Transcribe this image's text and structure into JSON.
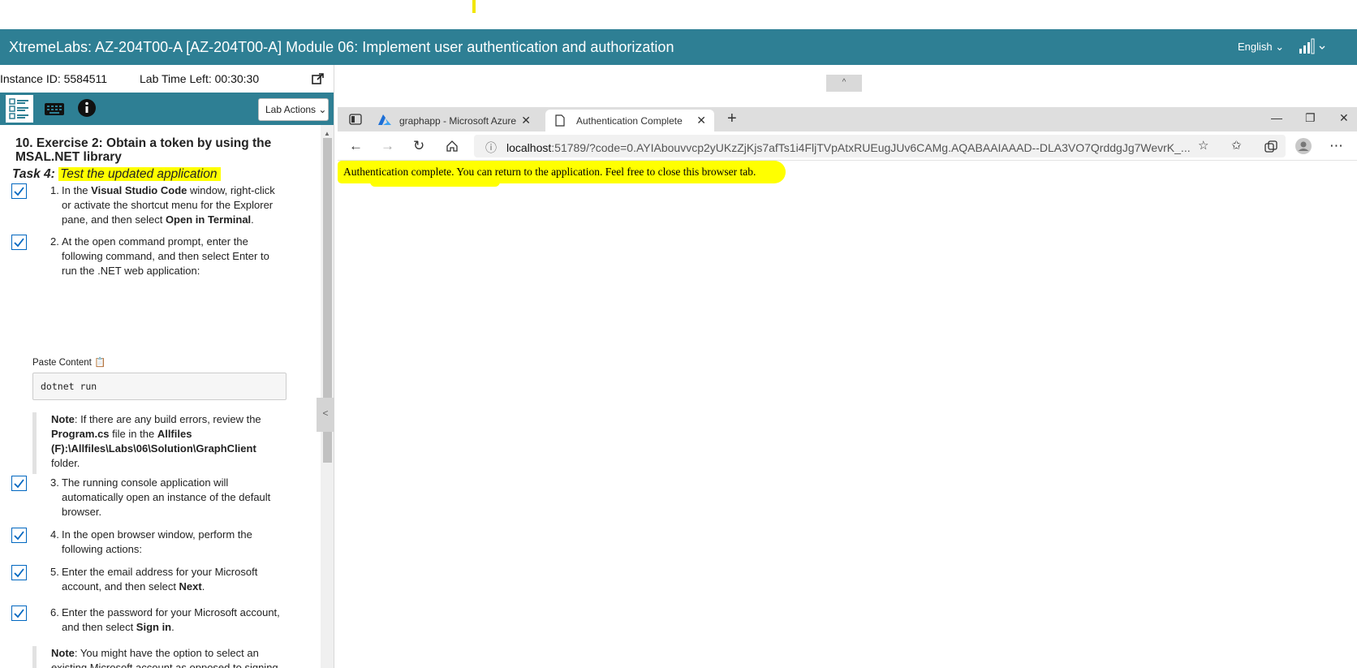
{
  "header": {
    "title": "XtremeLabs: AZ-204T00-A [AZ-204T00-A] Module 06: Implement user authentication and authorization",
    "language": "English"
  },
  "lab": {
    "instance_id": "Instance ID: 5584511",
    "time_left": "Lab Time Left: 00:30:30",
    "lab_actions": "Lab Actions"
  },
  "content": {
    "exercise_title": "10. Exercise 2: Obtain a token by using the MSAL.NET library",
    "task_prefix": "Task 4:",
    "task_title": "Test the updated application",
    "steps": [
      {
        "num": "1.",
        "pre": "In the ",
        "b1": "Visual Studio Code",
        "mid": " window, right-click or activate the shortcut menu for the Explorer pane, and then select ",
        "b2": "Open in Terminal",
        "post": ".",
        "checked": true
      },
      {
        "num": "2.",
        "pre": "At the open command prompt, enter the following command, and then select Enter to run the .NET web application:",
        "checked": true
      },
      {
        "num": "3.",
        "pre": "The running console application will automatically open an instance of the default browser.",
        "checked": true
      },
      {
        "num": "4.",
        "pre": "In the open browser window, perform the following actions:",
        "checked": true
      },
      {
        "num": "5.",
        "pre": "Enter the email address for your Microsoft account, and then select ",
        "b1": "Next",
        "post": ".",
        "checked": true
      },
      {
        "num": "6.",
        "pre": "Enter the password for your Microsoft account, and then select ",
        "b1": "Sign in",
        "post": ".",
        "checked": true
      }
    ],
    "paste_label": "Paste Content",
    "code": "dotnet run",
    "note1": {
      "label": "Note",
      "t1": ": If there are any build errors, review the ",
      "b1": "Program.cs",
      "t2": " file in the ",
      "b2": "Allfiles (F):\\Allfiles\\Labs\\06\\Solution\\GraphClient",
      "t3": " folder."
    },
    "note2": {
      "label": "Note",
      "t1": ": You might have the option to select an existing Microsoft account as opposed to signing in again."
    }
  },
  "browser": {
    "tabs": [
      {
        "label": "graphapp - Microsoft Azure",
        "active": false
      },
      {
        "label": "Authentication Complete",
        "active": true
      }
    ],
    "url_host": "localhost",
    "url_rest": ":51789/?code=0.AYIAbouvvcp2yUKzZjKjs7afTs1i4FljTVpAtxRUEugJUv6CAMg.AQABAAIAAAD--DLA3VO7QrddgJg7WevrK_...",
    "page_message": "Authentication complete. You can return to the application. Feel free to close this browser tab."
  },
  "colors": {
    "header_bg": "#2e7f94",
    "highlight": "#ffff00",
    "checkbox": "#0067c0"
  },
  "icons": [
    "signal-icon",
    "popout-icon",
    "checklist-icon",
    "keyboard-icon",
    "info-icon",
    "azure-icon",
    "page-icon",
    "back-icon",
    "forward-icon",
    "refresh-icon",
    "home-icon",
    "favorite-add-icon",
    "favorites-icon",
    "collections-icon",
    "profile-icon",
    "more-icon"
  ]
}
